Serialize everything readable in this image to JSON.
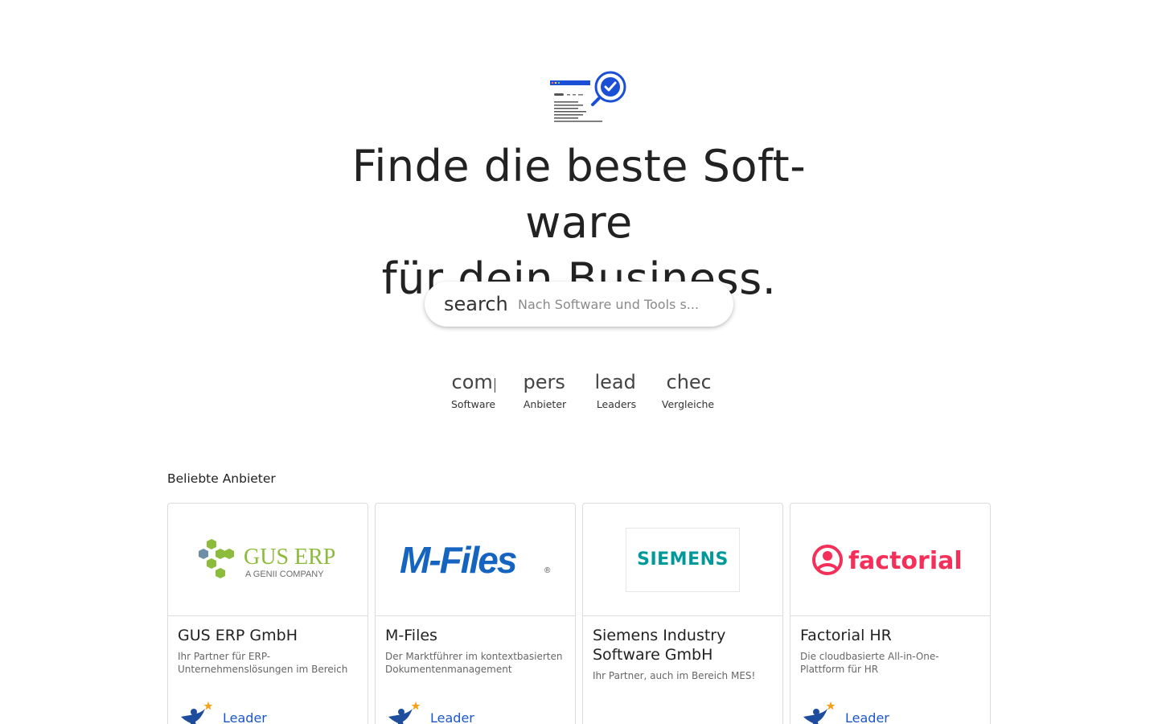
{
  "hero": {
    "title_line1": "Finde die beste Soft-",
    "title_line2": "ware",
    "title_line3": "für dein Business."
  },
  "search": {
    "icon_text": "search",
    "placeholder": "Nach Software und Tools s..."
  },
  "quick_links": [
    {
      "icon_text": "comp",
      "label": "Software",
      "icon": "category-icon"
    },
    {
      "icon_text": "pers",
      "label": "Anbieter",
      "icon": "person-icon"
    },
    {
      "icon_text": "lead",
      "label": "Leaders",
      "icon": "leaderboard-icon"
    },
    {
      "icon_text": "chec",
      "label": "Vergleiche",
      "icon": "checklist-icon"
    }
  ],
  "popular": {
    "title": "Beliebte Anbieter",
    "cards": [
      {
        "name": "GUS ERP GmbH",
        "description": "Ihr Partner für ERP-Unternehmenslösungen im Bereich",
        "badge": "Leader",
        "logo": {
          "main": "GUS ERP",
          "sub": "A GENII COMPANY"
        }
      },
      {
        "name": "M-Files",
        "description": "Der Marktführer im kontextbasierten Dokumentenmanagement",
        "badge": "Leader",
        "logo": {
          "main": "M-Files",
          "reg": "®"
        }
      },
      {
        "name": "Siemens Industry Software GmbH",
        "description": "Ihr Partner, auch im Bereich MES!",
        "badge": "",
        "logo": {
          "main": "SIEMENS"
        }
      },
      {
        "name": "Factorial HR",
        "description": "Die cloudbasierte All-in-One-Plattform für HR",
        "badge": "Leader",
        "logo": {
          "main": "factorial"
        }
      }
    ]
  },
  "colors": {
    "accent_blue": "#1a56c8",
    "hero_icon_blue": "#1a4fd6",
    "gus_green": "#8dbb3c",
    "gus_grey": "#6f8fa6",
    "mfiles_blue": "#1565c0",
    "mfiles_grey": "#4d4d4f",
    "siemens_teal": "#009999",
    "factorial_red": "#f4305a",
    "badge_star": "#f2a31b"
  }
}
